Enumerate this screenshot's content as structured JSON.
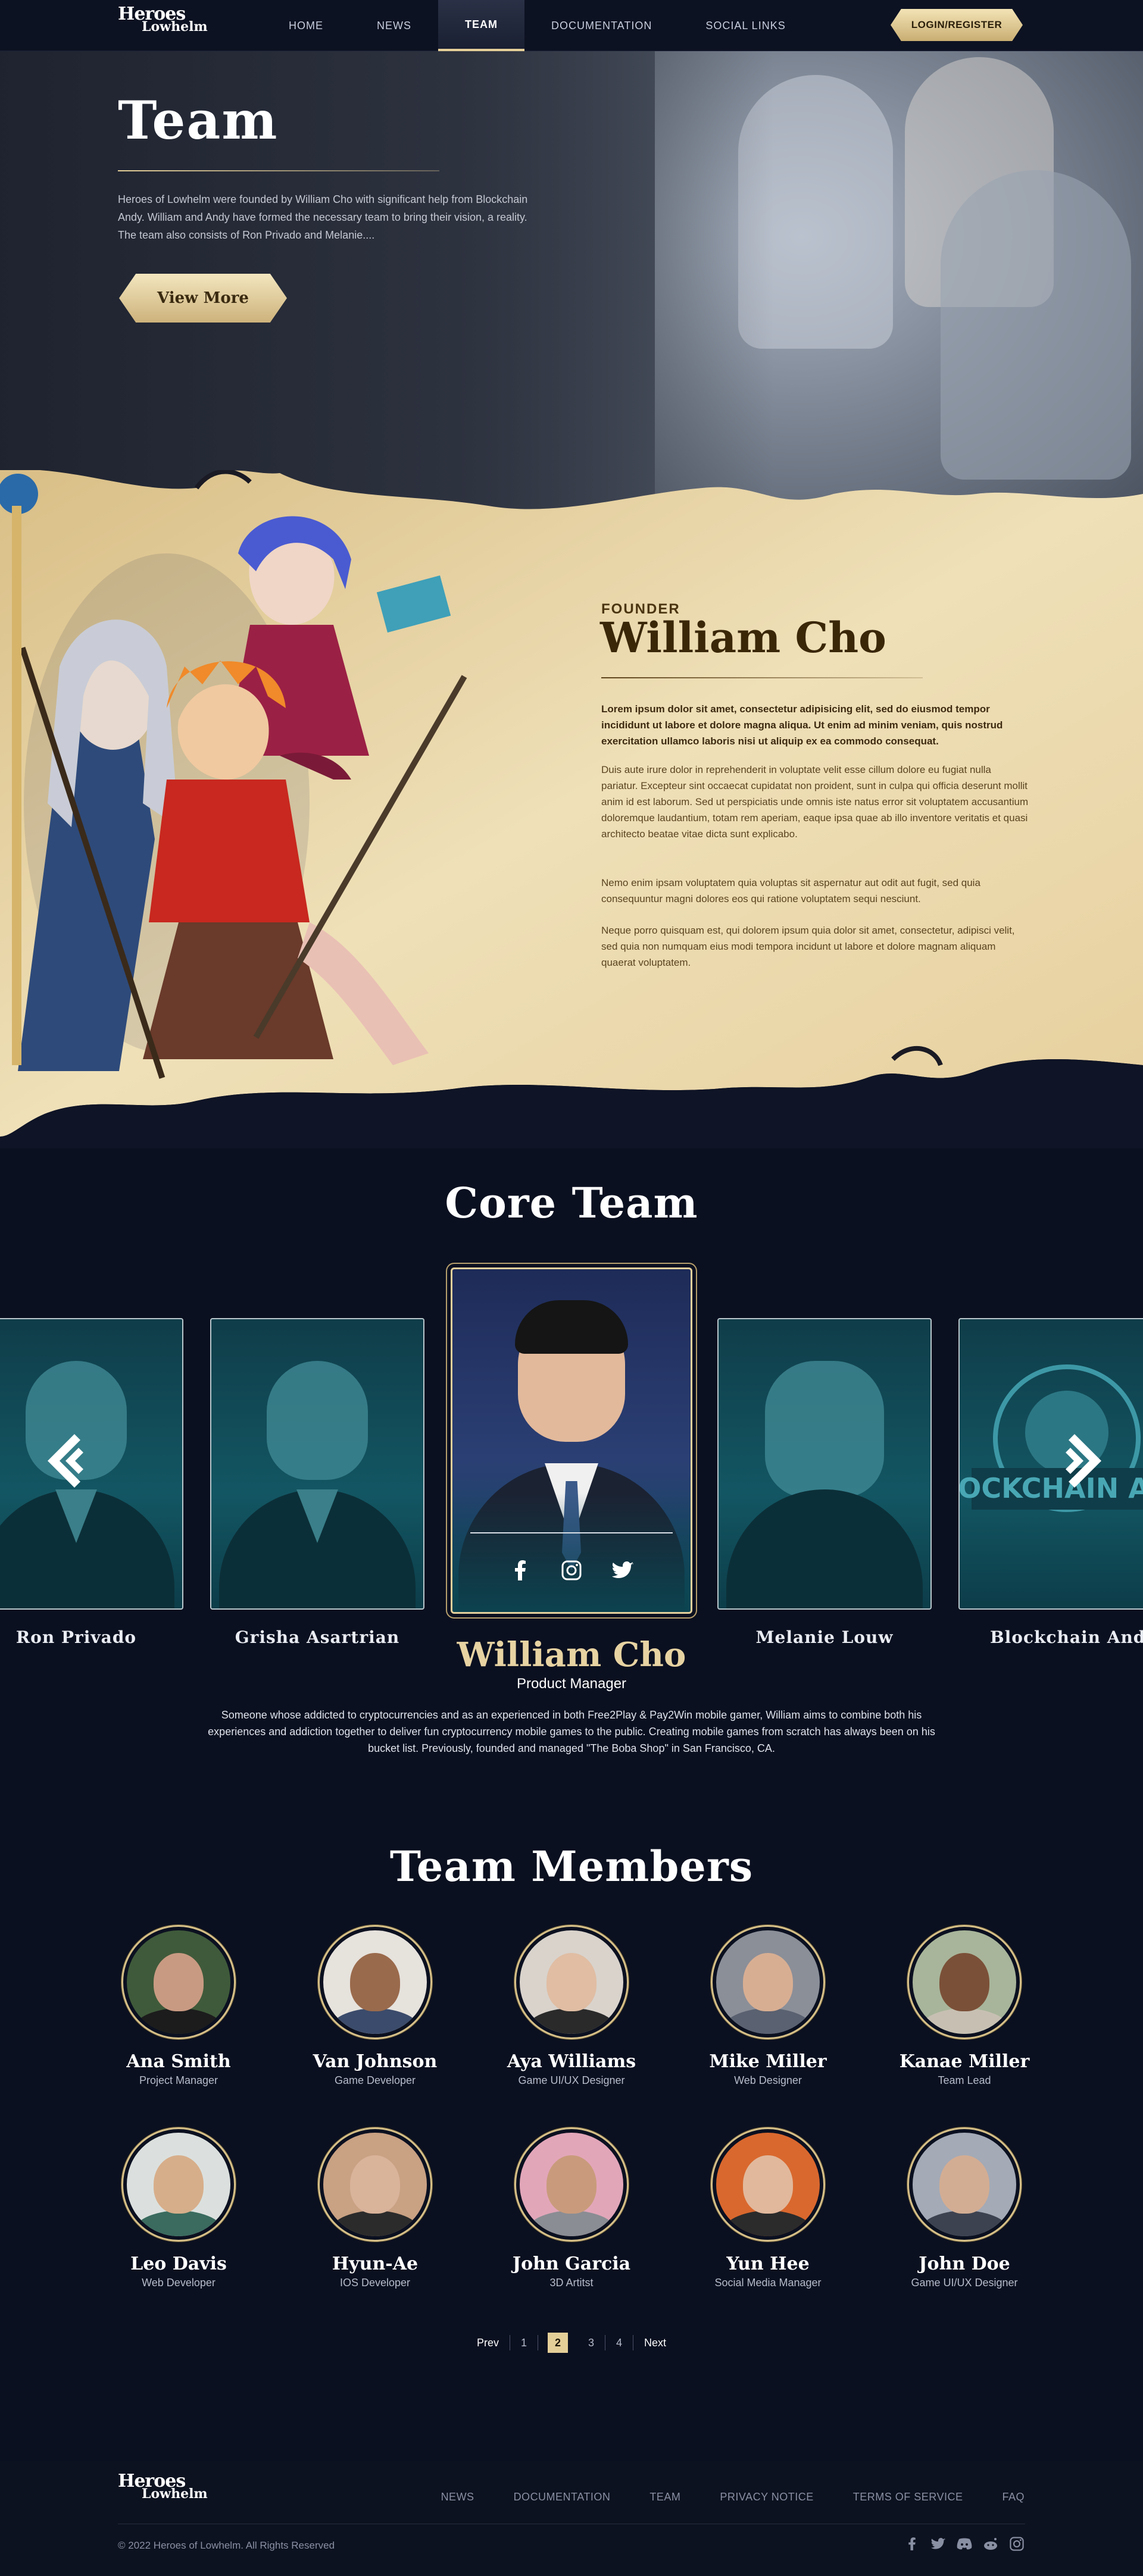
{
  "nav": {
    "logo_line1": "Heroes",
    "logo_line2": "Lowhelm",
    "links": [
      "HOME",
      "NEWS",
      "TEAM",
      "DOCUMENTATION",
      "SOCIAL LINKS"
    ],
    "active": "TEAM",
    "login": "LOGIN/REGISTER"
  },
  "hero": {
    "title": "Team",
    "text": "Heroes of Lowhelm were founded by William Cho with significant help from Blockchain Andy. William and Andy have formed the necessary team to bring their vision, a reality. The team also consists of Ron Privado and Melanie....",
    "button": "View More"
  },
  "founder": {
    "label": "FOUNDER",
    "name": "William Cho",
    "lead": "Lorem ipsum dolor sit amet, consectetur adipisicing elit, sed do eiusmod tempor incididunt ut labore et dolore magna aliqua. Ut enim ad minim veniam, quis nostrud exercitation ullamco laboris nisi ut aliquip ex ea commodo consequat.",
    "p1": "Duis aute irure dolor in reprehenderit in voluptate velit esse cillum dolore eu fugiat nulla pariatur. Excepteur sint occaecat cupidatat non proident, sunt in culpa qui officia deserunt mollit anim id est laborum. Sed ut perspiciatis unde omnis iste natus error sit voluptatem accusantium doloremque laudantium, totam rem aperiam, eaque ipsa quae ab illo inventore veritatis et quasi architecto beatae vitae dicta sunt explicabo.",
    "p2": "Nemo enim ipsam voluptatem quia voluptas sit aspernatur aut odit aut fugit, sed quia consequuntur magni dolores eos qui ratione voluptatem sequi nesciunt.",
    "p3": "Neque porro quisquam est, qui dolorem ipsum quia dolor sit amet, consectetur, adipisci velit, sed quia non numquam eius modi tempora incidunt ut labore et dolore magnam aliquam quaerat voluptatem."
  },
  "core_team": {
    "title": "Core Team",
    "cards": [
      "Ron Privado",
      "Grisha Asartrian",
      "Melanie Louw",
      "Blockchain Andy"
    ],
    "featured": {
      "name": "William Cho",
      "role": "Product Manager",
      "bio": "Someone whose addicted to cryptocurrencies and as an experienced in both Free2Play & Pay2Win mobile gamer, William aims to combine both his experiences and addiction together to deliver fun cryptocurrency mobile games to the public. Creating mobile games from scratch has always been on his bucket list. Previously, founded and managed \"The Boba Shop\" in San Francisco, CA."
    },
    "card_logo_text": "BLOCKCHAIN ANDY"
  },
  "team_members": {
    "title": "Team Members",
    "members": [
      {
        "name": "Ana Smith",
        "role": "Project Manager",
        "skin": "#c99a82",
        "bg": "#3f5a3a",
        "body": "#1c1c1c"
      },
      {
        "name": "Van Johnson",
        "role": "Game Developer",
        "skin": "#9a6a4c",
        "bg": "#e6e2dc",
        "body": "#3b4b6b"
      },
      {
        "name": "Aya Williams",
        "role": "Game UI/UX Designer",
        "skin": "#e0bda3",
        "bg": "#d9d3cc",
        "body": "#2a2a2a"
      },
      {
        "name": "Mike Miller",
        "role": "Web Designer",
        "skin": "#d8ae92",
        "bg": "#8b8f98",
        "body": "#5a6170"
      },
      {
        "name": "Kanae Miller",
        "role": "Team Lead",
        "skin": "#7b5038",
        "bg": "#a8b59a",
        "body": "#c7c0b2"
      },
      {
        "name": "Leo Davis",
        "role": "Web Developer",
        "skin": "#d7ae8a",
        "bg": "#dbe0de",
        "body": "#3a6b5e"
      },
      {
        "name": "Hyun-Ae",
        "role": "IOS Developer",
        "skin": "#d9b39a",
        "bg": "#c9a183",
        "body": "#2b2b2b"
      },
      {
        "name": "John Garcia",
        "role": "3D Artitst",
        "skin": "#c99b7c",
        "bg": "#e2a6b9",
        "body": "#8a8d93"
      },
      {
        "name": "Yun Hee",
        "role": "Social Media Manager",
        "skin": "#e1b89c",
        "bg": "#d9682e",
        "body": "#2b2b2b"
      },
      {
        "name": "John Doe",
        "role": "Game UI/UX Designer",
        "skin": "#d3ad93",
        "bg": "#a4aab6",
        "body": "#3d4250"
      }
    ]
  },
  "pagination": {
    "prev": "Prev",
    "pages": [
      "1",
      "2",
      "3",
      "4"
    ],
    "current": "2",
    "next": "Next"
  },
  "footer": {
    "logo_line1": "Heroes",
    "logo_line2": "Lowhelm",
    "links": [
      "NEWS",
      "DOCUMENTATION",
      "TEAM",
      "PRIVACY NOTICE",
      "TERMS OF SERVICE",
      "FAQ"
    ],
    "copyright": "© 2022 Heroes of Lowhelm. All Rights Reserved",
    "socials": [
      "facebook-icon",
      "twitter-icon",
      "discord-icon",
      "reddit-icon",
      "instagram-icon"
    ]
  },
  "colors": {
    "gold": "#e5cf98",
    "navy": "#0b1020",
    "teal": "#135663",
    "parchment": "#e8d3a2"
  }
}
